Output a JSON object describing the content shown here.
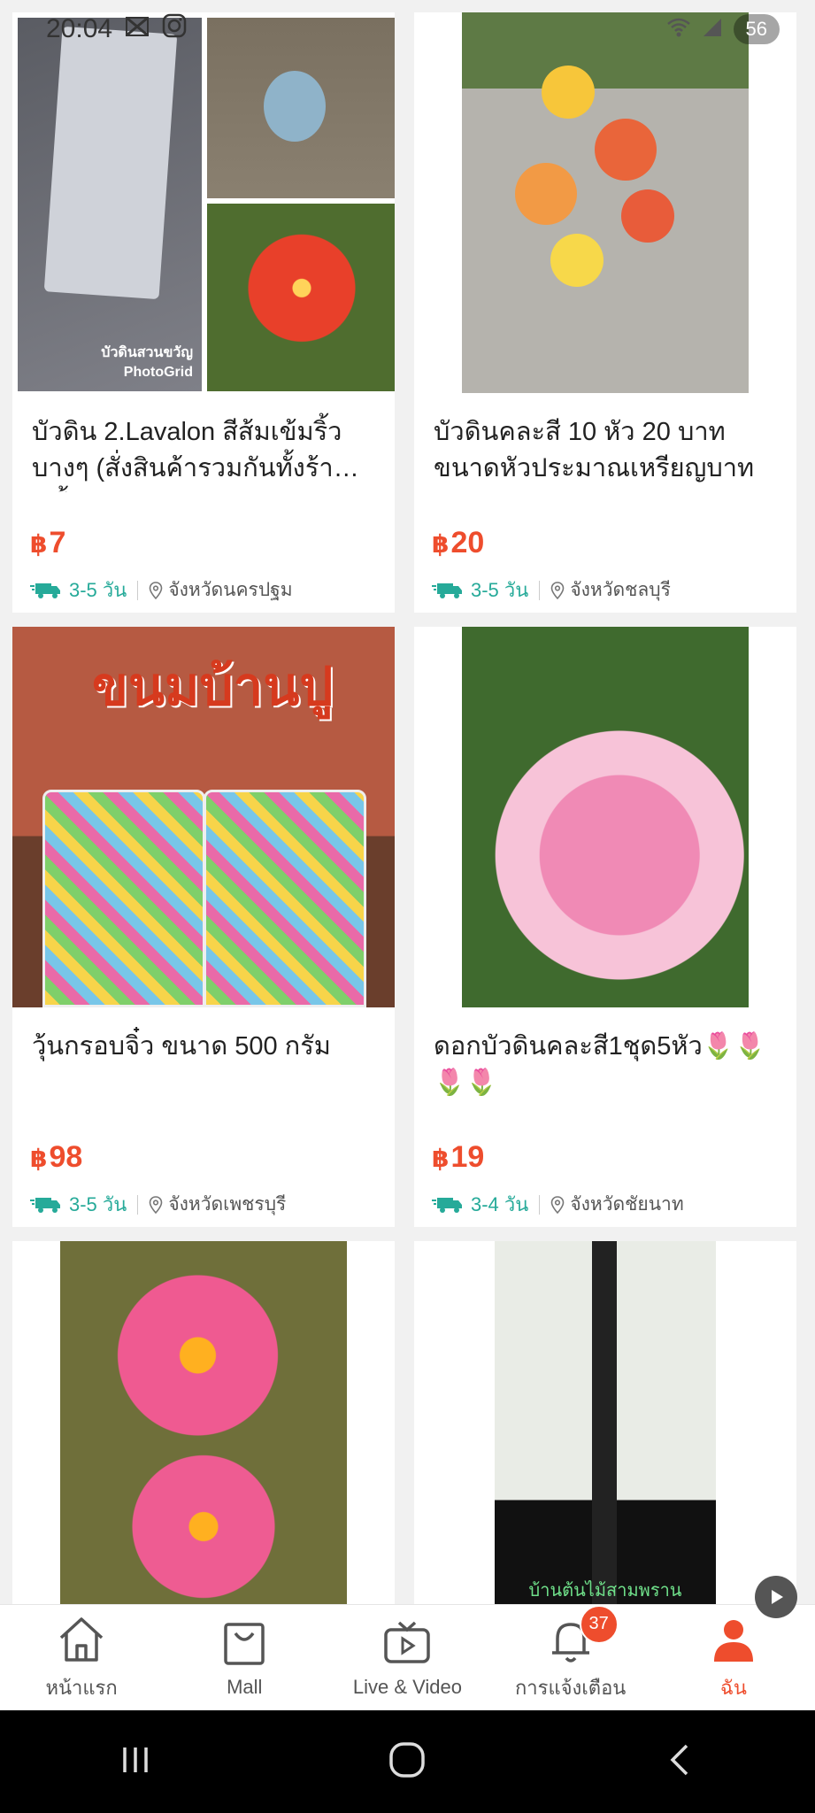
{
  "status": {
    "time": "20:04",
    "battery": "56"
  },
  "products": [
    {
      "title": "บัวดิน 2.Lavalon สีส้มเข้มริ้วบางๆ (สั่งสินค้ารวมกันทั้งร้านขั้...",
      "currency": "฿",
      "price": "7",
      "shipping": "3-5 วัน",
      "location": "จังหวัดนครปฐม",
      "image_text": "บัวดินสวนขวัญ\nPhotoGrid"
    },
    {
      "title": "บัวดินคละสี 10 หัว 20 บาท ขนาดหัวประมาณเหรียญบาท",
      "currency": "฿",
      "price": "20",
      "shipping": "3-5 วัน",
      "location": "จังหวัดชลบุรี"
    },
    {
      "title": "วุ้นกรอบจิ๋ว ขนาด 500 กรัม",
      "currency": "฿",
      "price": "98",
      "shipping": "3-5 วัน",
      "location": "จังหวัดเพชรบุรี",
      "image_text": "ขนมบ้านปู"
    },
    {
      "title": "ดอกบัวดินคละสี1ชุด5หัว🌷🌷🌷🌷",
      "currency": "฿",
      "price": "19",
      "shipping": "3-4 วัน",
      "location": "จังหวัดชัยนาท"
    },
    {
      "title": "",
      "image_only": true
    },
    {
      "title": "",
      "image_only": true,
      "image_text": "บ้านต้นไม้สามพราน"
    }
  ],
  "bottom_nav": [
    {
      "label": "หน้าแรก",
      "icon": "home-icon"
    },
    {
      "label": "Mall",
      "icon": "mall-bag-icon"
    },
    {
      "label": "Live & Video",
      "icon": "live-video-icon"
    },
    {
      "label": "การแจ้งเตือน",
      "icon": "bell-icon",
      "badge": "37"
    },
    {
      "label": "ฉัน",
      "icon": "profile-icon",
      "active": true
    }
  ],
  "colors": {
    "accent": "#ee4d2d",
    "shipping": "#26aa99"
  }
}
